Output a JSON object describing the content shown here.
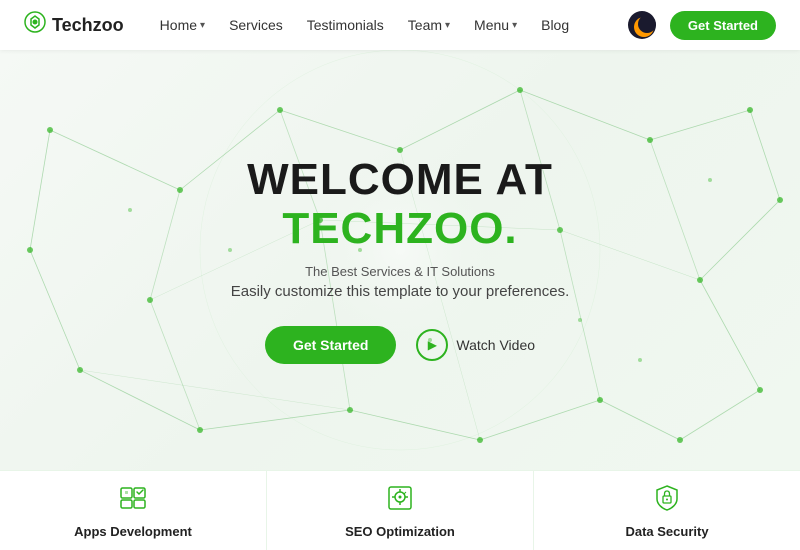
{
  "brand": {
    "name": "Techzoo",
    "logo_icon": "🐾"
  },
  "navbar": {
    "links": [
      {
        "label": "Home",
        "has_dropdown": true
      },
      {
        "label": "Services",
        "has_dropdown": false
      },
      {
        "label": "Testimonials",
        "has_dropdown": false
      },
      {
        "label": "Team",
        "has_dropdown": true
      },
      {
        "label": "Menu",
        "has_dropdown": true
      },
      {
        "label": "Blog",
        "has_dropdown": false
      }
    ],
    "cta_label": "Get Started"
  },
  "hero": {
    "title_line1": "WELCOME AT",
    "title_line2": "TECHZOO.",
    "subtitle": "The Best Services & IT Solutions",
    "description": "Easily customize this template to your preferences.",
    "btn_primary": "Get Started",
    "btn_secondary": "Watch Video"
  },
  "cards": [
    {
      "label": "Apps Development",
      "icon": "apps"
    },
    {
      "label": "SEO Optimization",
      "icon": "seo"
    },
    {
      "label": "Data Security",
      "icon": "security"
    }
  ],
  "colors": {
    "green": "#2db31f",
    "dark": "#1a1a1a",
    "text_muted": "#555"
  }
}
